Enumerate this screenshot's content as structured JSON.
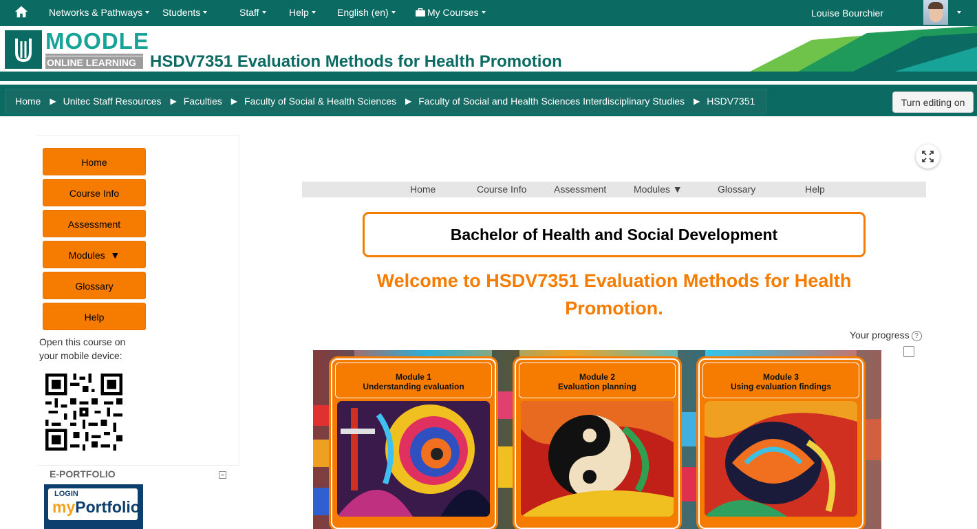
{
  "topnav": {
    "items": [
      {
        "label": "Networks & Pathways"
      },
      {
        "label": "Students"
      },
      {
        "label": "Staff"
      },
      {
        "label": "Help"
      },
      {
        "label": "English (en)"
      },
      {
        "label": "My Courses"
      }
    ],
    "user_name": "Louise Bourchier",
    "icons": {
      "home": "home-icon",
      "courses": "briefcase-icon"
    }
  },
  "banner": {
    "logo_line1": "MOODLE",
    "logo_line2": "ONLINE LEARNING",
    "course_title": "HSDV7351 Evaluation Methods for Health Promotion"
  },
  "breadcrumb": [
    "Home",
    "Unitec Staff Resources",
    "Faculties",
    "Faculty of Social & Health Sciences",
    "Faculty of Social and Health Sciences Interdisciplinary Studies",
    "HSDV7351"
  ],
  "edit_button": "Turn editing on",
  "left_nav": {
    "buttons": [
      "Home",
      "Course Info",
      "Assessment",
      "Modules  ▼",
      "Glossary",
      "Help"
    ],
    "mobile_text_line1": "Open this course on",
    "mobile_text_line2": "your mobile device:"
  },
  "eportfolio": {
    "title": "E-PORTFOLIO",
    "login_label": "LOGIN",
    "brand_my": "my",
    "brand_portfolio": "Portfolio"
  },
  "course_menu": [
    "Home",
    "Course Info",
    "Assessment",
    "Modules ▼",
    "Glossary",
    "Help"
  ],
  "program_title": "Bachelor of Health and Social Development",
  "welcome_line1": "Welcome to HSDV7351 Evaluation Methods for Health",
  "welcome_line2": "Promotion.",
  "progress_label": "Your progress",
  "modules": [
    {
      "number": "Module 1",
      "title": "Understanding evaluation"
    },
    {
      "number": "Module 2",
      "title": "Evaluation planning"
    },
    {
      "number": "Module 3",
      "title": "Using evaluation findings"
    }
  ],
  "colors": {
    "brand_teal": "#0b6b63",
    "accent_orange": "#f57c00",
    "logo_teal": "#18a398"
  }
}
